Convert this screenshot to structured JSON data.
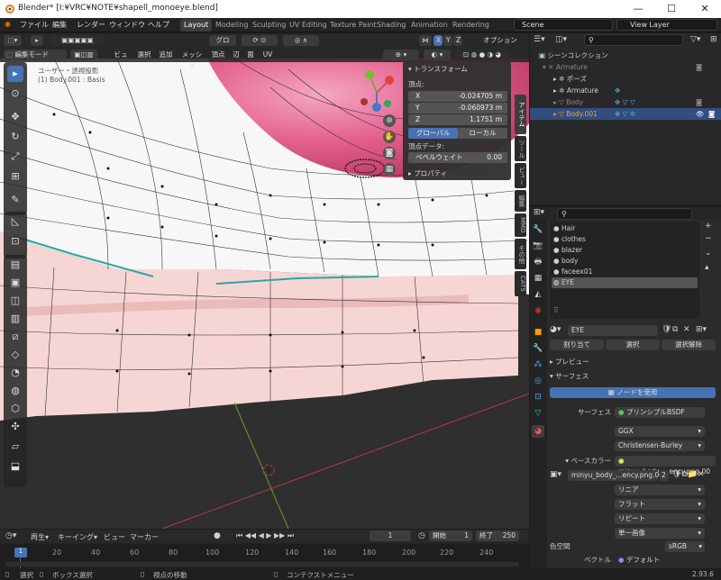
{
  "window": {
    "title": "Blender* [I:¥VRC¥NOTE¥shapell_monoeye.blend]",
    "min": "—",
    "max": "☐",
    "close": "✕"
  },
  "menu": [
    "ファイル",
    "編集",
    "レンダー",
    "ウィンドウ",
    "ヘルプ"
  ],
  "workspaces": [
    "Layout",
    "Modeling",
    "Sculpting",
    "UV Editing",
    "Texture Paint",
    "Shading",
    "Animation",
    "Rendering"
  ],
  "scene": "Scene",
  "view_layer": "View Layer",
  "viewport": {
    "orientation": "グロー…",
    "options": "オプション",
    "axes": [
      "X",
      "Y",
      "Z"
    ],
    "mode": "編集モード",
    "menus": [
      "ビュー",
      "選択",
      "追加",
      "メッシュ",
      "頂点",
      "辺",
      "面",
      "UV"
    ],
    "overlay_line1": "ユーザー・透視投影",
    "overlay_line2": "(1) Body.001 : Basis",
    "vtabs": [
      "アイテム",
      "ツール",
      "ビュー",
      "編集",
      "MMD",
      "その他",
      "CATS"
    ]
  },
  "npanel": {
    "transform": "トランスフォーム",
    "vertex": "頂点:",
    "x_label": "X",
    "x_value": "-0.024705 m",
    "y_label": "Y",
    "y_value": "-0.060973 m",
    "z_label": "Z",
    "z_value": "1.1751 m",
    "global": "グローバル",
    "local": "ローカル",
    "vertex_data": "頂点データ:",
    "bevel_label": "ベベルウェイト",
    "bevel_value": "0.00",
    "properties": "プロパティ"
  },
  "outliner": {
    "search": "",
    "rows": [
      {
        "label": "シーンコレクション",
        "indent": 0
      },
      {
        "label": "Armature",
        "indent": 1
      },
      {
        "label": "ポーズ",
        "indent": 2
      },
      {
        "label": "Armature",
        "indent": 2
      },
      {
        "label": "Body",
        "indent": 2
      },
      {
        "label": "Body.001",
        "indent": 2
      }
    ]
  },
  "materials": {
    "slots": [
      "Hair",
      "clothes",
      "blazer",
      "body",
      "faceex01",
      "EYE"
    ],
    "active": "EYE",
    "name": "EYE",
    "assign": "割り当て",
    "select": "選択",
    "deselect": "選択解除",
    "preview": "プレビュー",
    "surface_section": "サーフェス",
    "use_nodes": "ノードを使用",
    "surface_label": "サーフェス",
    "surface_value": "プリンシプルBSDF",
    "distribution": "GGX",
    "subsurface": "Christensen-Burley",
    "base_color_label": "ベースカラー",
    "base_color_value": "minyu_body_...ency.png.00",
    "image_name": "minyu_body_...ency.png.003",
    "image_users": "2",
    "interp": "リニア",
    "proj": "フラット",
    "ext": "リピート",
    "source": "単一画像",
    "colorspace_label": "色空間",
    "colorspace_value": "sRGB",
    "vector_label": "ベクトル",
    "vector_value": "デフォルト"
  },
  "timeline": {
    "playback": "再生",
    "keying": "キーイング",
    "view": "ビュー",
    "marker": "マーカー",
    "current": "1",
    "start_label": "開始",
    "start": "1",
    "end_label": "終了",
    "end": "250",
    "ticks": [
      "1",
      "20",
      "40",
      "60",
      "80",
      "100",
      "120",
      "140",
      "160",
      "180",
      "200",
      "220",
      "240"
    ]
  },
  "status": {
    "select": "選択",
    "box": "ボックス選択",
    "move": "視点の移動",
    "context": "コンテクストメニュー",
    "version": "2.93.6"
  },
  "colors": {
    "accent": "#4772b3",
    "pink": "#e4608e",
    "mesh_pink": "#f6d6d4"
  }
}
